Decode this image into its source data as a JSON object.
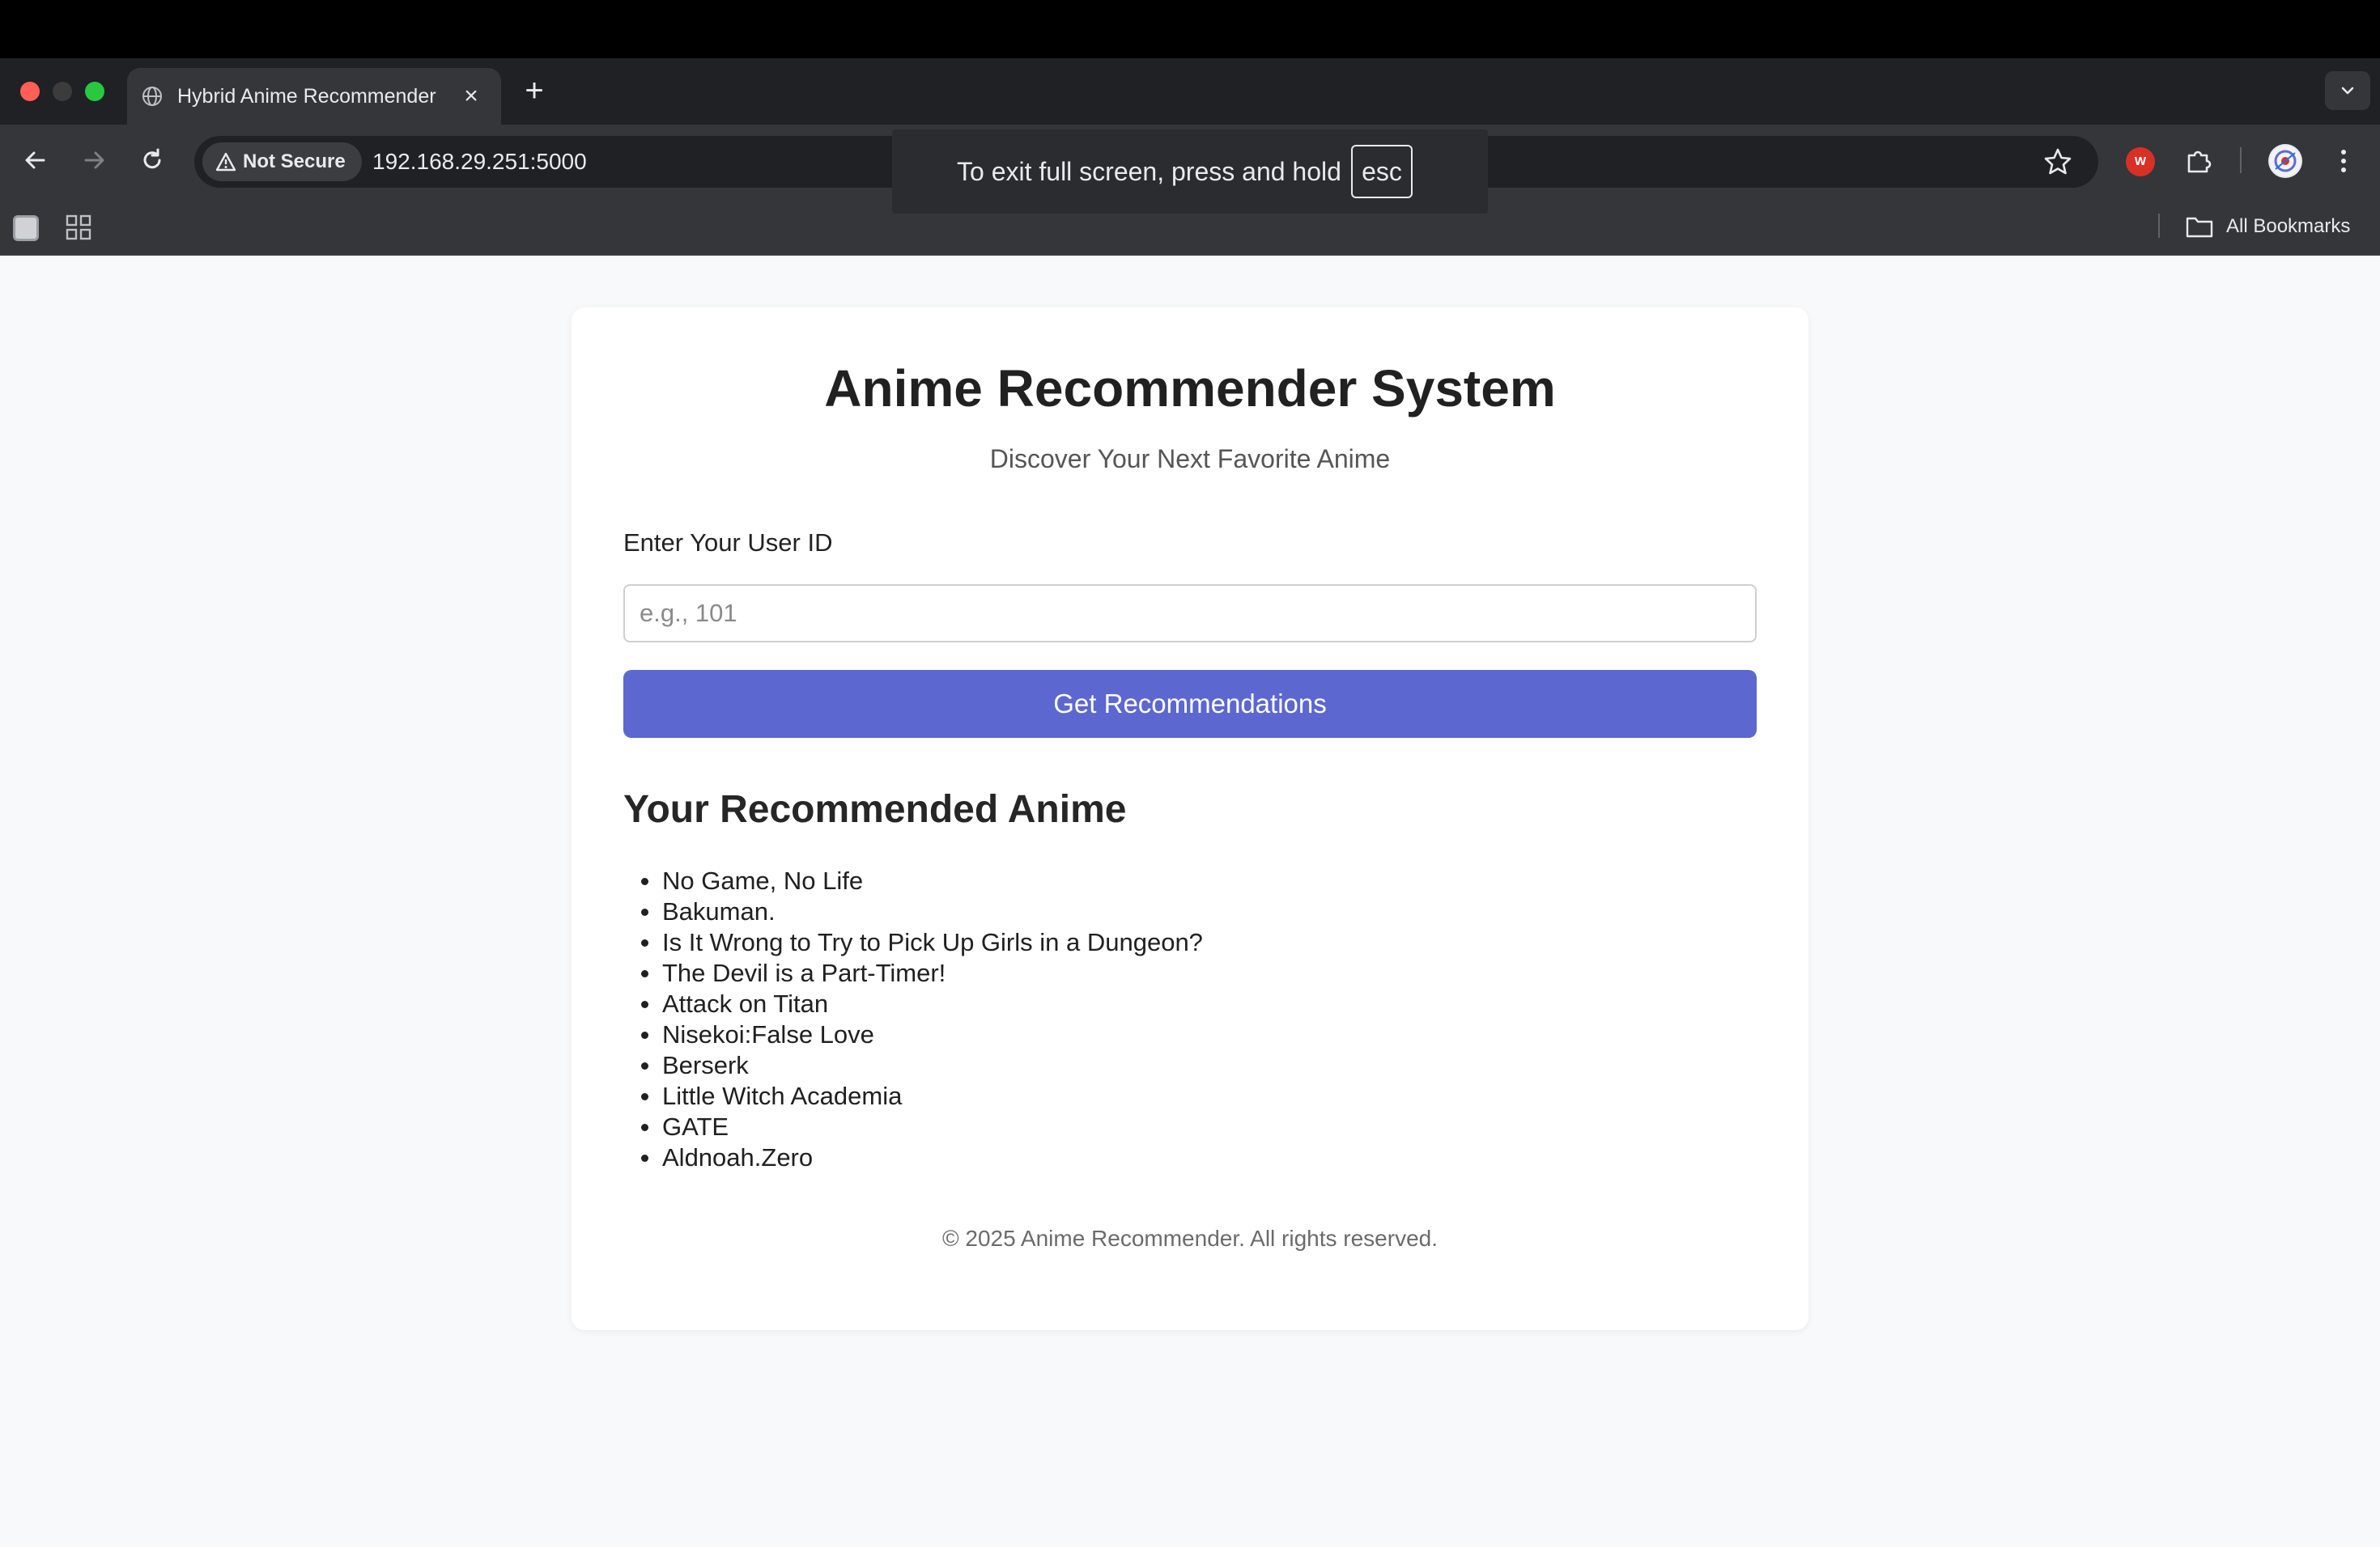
{
  "browser": {
    "tab_title": "Hybrid Anime Recommender",
    "security_label": "Not Secure",
    "url": "192.168.29.251:5000",
    "bookmarks_label": "All Bookmarks",
    "extension_badge": "W",
    "fullscreen_notice": {
      "text": "To exit full screen, press and hold",
      "key": "esc"
    }
  },
  "page": {
    "title": "Anime Recommender System",
    "subtitle": "Discover Your Next Favorite Anime",
    "form": {
      "label": "Enter Your User ID",
      "placeholder": "e.g., 101",
      "value": "",
      "button_label": "Get Recommendations"
    },
    "results": {
      "heading": "Your Recommended Anime",
      "items": [
        "No Game, No Life",
        "Bakuman.",
        "Is It Wrong to Try to Pick Up Girls in a Dungeon?",
        "The Devil is a Part-Timer!",
        "Attack on Titan",
        "Nisekoi:False Love",
        "Berserk",
        "Little Witch Academia",
        "GATE",
        "Aldnoah.Zero"
      ]
    },
    "footer": "© 2025 Anime Recommender. All rights reserved."
  },
  "colors": {
    "accent_button": "#5c67d0",
    "page_background": "#f8f9fa",
    "card_background": "#ffffff"
  }
}
